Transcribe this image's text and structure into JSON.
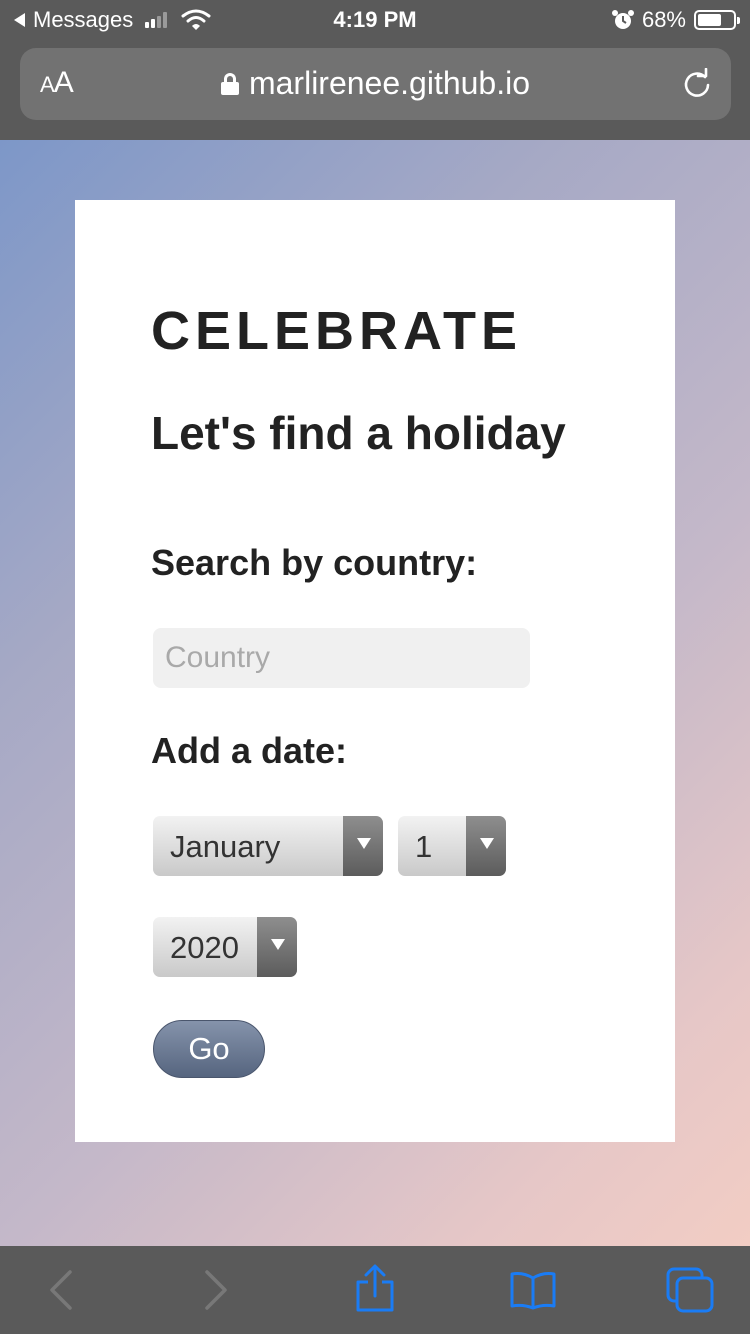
{
  "status_bar": {
    "back_app": "Messages",
    "time": "4:19 PM",
    "battery_percent": "68%",
    "battery_level": 0.68,
    "signal_bars": 2
  },
  "browser": {
    "text_size_label_small": "A",
    "text_size_label_large": "A",
    "url": "marlirenee.github.io"
  },
  "page": {
    "brand": "CELEBRATE",
    "headline": "Let's find a holiday",
    "country_label": "Search by country:",
    "country_placeholder": "Country",
    "country_value": "",
    "date_label": "Add a date:",
    "month_selected": "January",
    "day_selected": "1",
    "year_selected": "2020",
    "go_label": "Go"
  },
  "colors": {
    "gradient_start": "#7d97c8",
    "gradient_end": "#f2cdc4",
    "go_button": "#6b7994",
    "toolbar_active_icon": "#1a7cf5",
    "toolbar_disabled_icon": "#787878"
  },
  "toolbar": {
    "items": [
      "back-icon",
      "forward-icon",
      "share-icon",
      "bookmarks-icon",
      "tabs-icon"
    ]
  }
}
